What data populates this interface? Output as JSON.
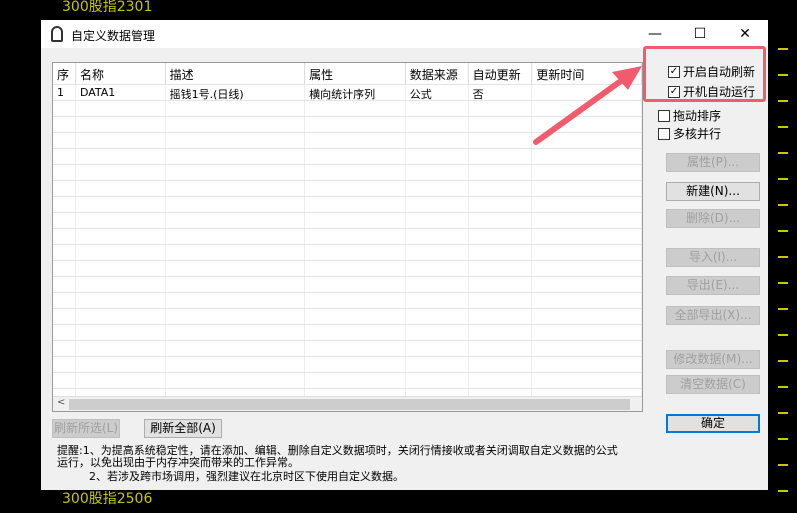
{
  "background": {
    "top_label": "300股指2301",
    "bottom_label": "300股指2506"
  },
  "window": {
    "title": "自定义数据管理",
    "minimize": "—",
    "maximize": "☐",
    "close": "✕"
  },
  "table": {
    "columns": [
      "序",
      "名称",
      "描述",
      "属性",
      "数据来源",
      "自动更新",
      "更新时间"
    ],
    "rows": [
      [
        "1",
        "DATA1",
        "摇钱1号.(日线)",
        "横向统计序列",
        "公式",
        "否",
        ""
      ]
    ]
  },
  "options": {
    "auto_refresh": {
      "label": "开启自动刷新",
      "checked": true
    },
    "auto_start": {
      "label": "开机自动运行",
      "checked": true
    },
    "drag_sort": {
      "label": "拖动排序",
      "checked": false
    },
    "multicore": {
      "label": "多核并行",
      "checked": false
    }
  },
  "buttons": {
    "properties": "属性(P)...",
    "new": "新建(N)...",
    "delete": "删除(D)...",
    "import": "导入(I)...",
    "export": "导出(E)...",
    "export_all": "全部导出(X)...",
    "modify": "修改数据(M)...",
    "clear": "清空数据(C)",
    "ok": "确定",
    "refresh_selected": "刷新所选(L)",
    "refresh_all": "刷新全部(A)"
  },
  "note": {
    "line1": "提醒:1、为提高系统稳定性，请在添加、编辑、删除自定义数据项时，关闭行情接收或者关闭调取自定义数据的公式运行，以免出现由于内存冲突而带来的工作异常。",
    "line2": "2、若涉及跨市场调用，强烈建议在北京时区下使用自定义数据。"
  },
  "colors": {
    "highlight": "#f25a6e",
    "accent": "#0078d7"
  }
}
